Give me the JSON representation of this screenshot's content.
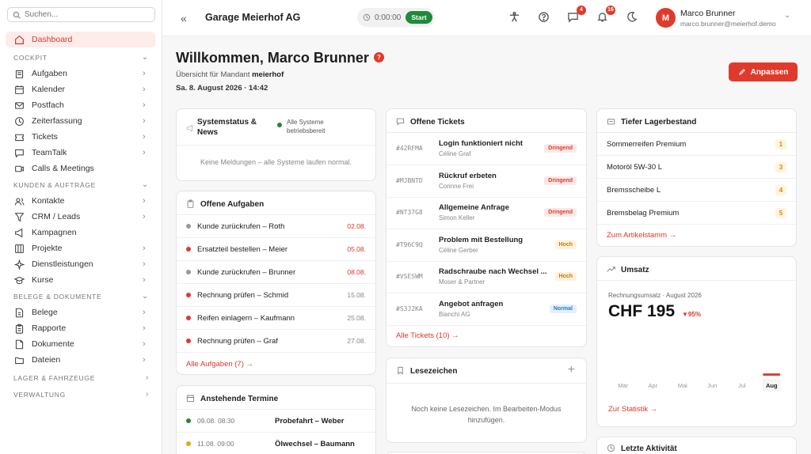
{
  "search": {
    "placeholder": "Suchen..."
  },
  "sidebar": {
    "dashboard": "Dashboard",
    "sections": {
      "cockpit": "COCKPIT",
      "kunden": "KUNDEN & AUFTRÄGE",
      "belege": "BELEGE & DOKUMENTE",
      "lager": "LAGER & FAHRZEUGE",
      "verwaltung": "VERWALTUNG"
    },
    "cockpit_items": [
      "Aufgaben",
      "Kalender",
      "Postfach",
      "Zeiterfassung",
      "Tickets",
      "TeamTalk",
      "Calls & Meetings"
    ],
    "kunden_items": [
      "Kontakte",
      "CRM / Leads",
      "Kampagnen",
      "Projekte",
      "Dienstleistungen",
      "Kurse"
    ],
    "belege_items": [
      "Belege",
      "Rapporte",
      "Dokumente",
      "Dateien"
    ]
  },
  "header": {
    "company": "Garage Meierhof AG",
    "timer": "0:00:00",
    "start": "Start",
    "messages_count": "4",
    "notifications_count": "16",
    "user_name": "Marco Brunner",
    "user_email": "marco.brunner@meierhof.demo",
    "avatar_initial": "M"
  },
  "welcome": {
    "title": "Willkommen, Marco Brunner",
    "subtitle_prefix": "Übersicht für Mandant",
    "tenant": "meierhof",
    "datetime": "Sa. 8. August 2026 · 14:42",
    "customize": "Anpassen"
  },
  "system": {
    "title": "Systemstatus & News",
    "status": "Alle Systeme betriebsbereit",
    "empty": "Keine Meldungen – alle Systeme laufen normal."
  },
  "tasks": {
    "title": "Offene Aufgaben",
    "items": [
      {
        "label": "Kunde zurückrufen – Roth",
        "date": "02.08.",
        "dot": "#999999",
        "date_color": "#d63a2c"
      },
      {
        "label": "Ersatzteil bestellen – Meier",
        "date": "05.08.",
        "dot": "#e03a2c",
        "date_color": "#d63a2c"
      },
      {
        "label": "Kunde zurückrufen – Brunner",
        "date": "08.08.",
        "dot": "#999999",
        "date_color": "#d63a2c"
      },
      {
        "label": "Rechnung prüfen – Schmid",
        "date": "15.08.",
        "dot": "#e03a2c",
        "date_color": "#888888"
      },
      {
        "label": "Reifen einlagern – Kaufmann",
        "date": "25.08.",
        "dot": "#e03a2c",
        "date_color": "#888888"
      },
      {
        "label": "Rechnung prüfen – Graf",
        "date": "27.08.",
        "dot": "#e03a2c",
        "date_color": "#888888"
      }
    ],
    "all_link": "Alle Aufgaben (7) →"
  },
  "appointments": {
    "title": "Anstehende Termine",
    "items": [
      {
        "when": "09.08. 08:30",
        "label": "Probefahrt – Weber",
        "dot": "#1f8a3a"
      },
      {
        "when": "11.08. 09:00",
        "label": "Ölwechsel – Baumann",
        "dot": "#e8a317"
      }
    ]
  },
  "tickets": {
    "title": "Offene Tickets",
    "items": [
      {
        "id": "#42RFMA",
        "subject": "Login funktioniert nicht",
        "customer": "Céline Graf",
        "priority": "Dringend",
        "bg": "#fde8e6",
        "fg": "#d63a2c"
      },
      {
        "id": "#MJBNTD",
        "subject": "Rückruf erbeten",
        "customer": "Corinne Frei",
        "priority": "Dringend",
        "bg": "#fde8e6",
        "fg": "#d63a2c"
      },
      {
        "id": "#NT37G8",
        "subject": "Allgemeine Anfrage",
        "customer": "Simon Keller",
        "priority": "Dringend",
        "bg": "#fde8e6",
        "fg": "#d63a2c"
      },
      {
        "id": "#T96C9Q",
        "subject": "Problem mit Bestellung",
        "customer": "Céline Gerber",
        "priority": "Hoch",
        "bg": "#fff1dd",
        "fg": "#c77a00"
      },
      {
        "id": "#VSESWM",
        "subject": "Radschraube nach Wechsel ...",
        "customer": "Moser & Partner",
        "priority": "Hoch",
        "bg": "#fff1dd",
        "fg": "#c77a00"
      },
      {
        "id": "#S3J2KA",
        "subject": "Angebot anfragen",
        "customer": "Bianchi AG",
        "priority": "Normal",
        "bg": "#e3f0fb",
        "fg": "#2f7ac0"
      }
    ],
    "all_link": "Alle Tickets (10) →"
  },
  "bookmarks": {
    "title": "Lesezeichen",
    "empty": "Noch keine Lesezeichen. Im Bearbeiten-Modus hinzufügen."
  },
  "stock": {
    "title": "Tiefer Lagerbestand",
    "items": [
      {
        "name": "Sommerreifen Premium",
        "qty": "1"
      },
      {
        "name": "Motoröl 5W-30 L",
        "qty": "3"
      },
      {
        "name": "Bremsscheibe L",
        "qty": "4"
      },
      {
        "name": "Bremsbelag Premium",
        "qty": "5"
      }
    ],
    "link": "Zum Artikelstamm →"
  },
  "revenue": {
    "title": "Umsatz",
    "caption": "Rechnungsumsatz · August 2026",
    "amount": "CHF 195",
    "change": "▼95%",
    "link": "Zur Statistik →"
  },
  "chart_data": {
    "type": "bar",
    "categories": [
      "Mär",
      "Apr",
      "Mai",
      "Jun",
      "Jul",
      "Aug"
    ],
    "values": [
      0,
      0,
      0,
      0,
      0,
      195
    ],
    "ylim": [
      0,
      4000
    ]
  },
  "activity": {
    "title": "Letzte Aktivität"
  },
  "colors": {
    "accent": "#e03a2c",
    "success": "#1f8a3a"
  }
}
